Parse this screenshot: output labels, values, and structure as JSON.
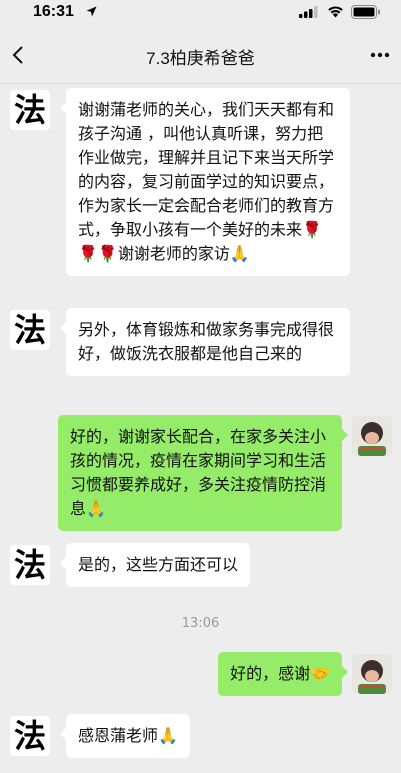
{
  "status_bar": {
    "time": "16:31"
  },
  "nav": {
    "title": "7.3柏庚希爸爸"
  },
  "contact_avatar_char": "法",
  "messages": [
    {
      "id": "m1",
      "side": "in",
      "text": "谢谢蒲老师的关心，我们天天都有和孩子沟通 ，叫他认真听课，努力把作业做完，理解并且记下来当天所学的内容，复习前面学过的知识要点，作为家长一定会配合老师们的教育方式，争取小孩有一个美好的未来🌹🌹🌹谢谢老师的家访🙏"
    },
    {
      "id": "m2",
      "side": "in",
      "text": "另外，体育锻炼和做家务事完成得很好，做饭洗衣服都是他自己来的"
    },
    {
      "id": "m3",
      "side": "out",
      "text": "好的，谢谢家长配合，在家多关注小孩的情况，疫情在家期间学习和生活习惯都要养成好，多关注疫情防控消息🙏"
    },
    {
      "id": "m4",
      "side": "in",
      "text": "是的，这些方面还可以"
    },
    {
      "id": "m5",
      "side": "out",
      "text": "好的，感谢🤝"
    },
    {
      "id": "m6",
      "side": "in",
      "text": "感恩蒲老师🙏"
    }
  ],
  "timestamp": "13:06",
  "icons": {
    "back": "chevron-left-icon",
    "more": "more-dots-icon",
    "location": "location-arrow-icon",
    "signal": "signal-bars-icon",
    "wifi": "wifi-icon",
    "battery": "battery-icon"
  },
  "colors": {
    "background": "#ededed",
    "outgoing_bubble": "#95ec69",
    "incoming_bubble": "#ffffff"
  }
}
